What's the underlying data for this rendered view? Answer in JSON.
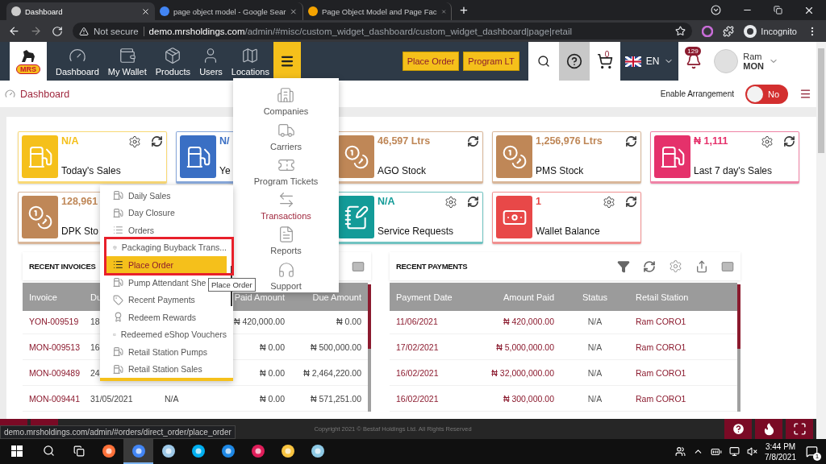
{
  "browser": {
    "tabs": [
      {
        "title": "Dashboard",
        "selected": true
      },
      {
        "title": "page object model - Google Sear",
        "selected": false
      },
      {
        "title": "Page Object Model and Page Fac",
        "selected": false
      }
    ],
    "new_tab": "+",
    "security": "Not secure",
    "url_host": "demo.mrsholdings.com",
    "url_path": "/admin/#misc/custom_widget_dashboard/custom_widget_dashboard|page|retail",
    "profile": "Incognito"
  },
  "nav": {
    "logo": "MRS",
    "items": [
      {
        "label": "Dashboard"
      },
      {
        "label": "My Wallet"
      },
      {
        "label": "Products"
      },
      {
        "label": "Users"
      },
      {
        "label": "Locations"
      }
    ],
    "actions": [
      "Place Order",
      "Program LT"
    ],
    "cart_count": "0",
    "language": "EN",
    "notifications": "129",
    "user": {
      "name": "Ram",
      "org": "MON"
    }
  },
  "toolbar": {
    "breadcrumb": "Dashboard",
    "arrangement_label": "Enable Arrangement",
    "arrangement": {
      "on": false,
      "text": "No"
    }
  },
  "cards": [
    [
      {
        "value": "N/A",
        "label": "Today's Sales",
        "color": "#f5c01b"
      },
      {
        "value": "N/",
        "label": "Ye",
        "color": "#3a6fc4"
      },
      {
        "value": "46,597 Ltrs",
        "label": "AGO Stock",
        "color": "#bf8757"
      },
      {
        "value": "1,256,976 Ltrs",
        "label": "PMS Stock",
        "color": "#bf8757"
      },
      {
        "value": "₦ 1,111",
        "label": "Last 7 day's Sales",
        "color": "#e5316b"
      }
    ],
    [
      {
        "value": "128,961",
        "label": "DPK Sto",
        "color": "#bf8757"
      },
      {
        "value": "N/A",
        "label": "Service Requests",
        "color": "#139b98"
      },
      {
        "value": "1",
        "label": "Wallet Balance",
        "color": "#e84848"
      }
    ]
  ],
  "invoices": {
    "title": "RECENT INVOICES",
    "columns": [
      "Invoice",
      "Du",
      null,
      "Paid Amount",
      "Due Amount"
    ],
    "rows": [
      [
        "YON-009519",
        "18",
        null,
        "₦ 420,000.00",
        "₦ 0.00"
      ],
      [
        "MON-009513",
        "16",
        null,
        "₦ 0.00",
        "₦ 500,000.00"
      ],
      [
        "MON-009489",
        "24",
        null,
        "₦ 0.00",
        "₦ 2,464,220.00"
      ],
      [
        "MON-009441",
        "31/05/2021",
        "N/A",
        "₦ 0.00",
        "₦ 571,251.00"
      ]
    ]
  },
  "payments": {
    "title": "RECENT PAYMENTS",
    "columns": [
      "Payment Date",
      "Amount Paid",
      "Status",
      "Retail Station"
    ],
    "rows": [
      [
        "11/06/2021",
        "₦ 420,000.00",
        "N/A",
        "Ram CORO1"
      ],
      [
        "17/02/2021",
        "₦ 5,000,000.00",
        "N/A",
        "Ram CORO1"
      ],
      [
        "16/02/2021",
        "₦ 32,000,000.00",
        "N/A",
        "Ram CORO1"
      ],
      [
        "16/02/2021",
        "₦ 300,000.00",
        "N/A",
        "Ram CORO1"
      ]
    ]
  },
  "footer": {
    "copyright": "Copyright 2021 © Bestaf Holdings Ltd. All Rights Reserved"
  },
  "mega_menu": [
    {
      "label": "Companies",
      "selected": false
    },
    {
      "label": "Carriers",
      "selected": false
    },
    {
      "label": "Program Tickets",
      "selected": false
    },
    {
      "label": "Transactions",
      "selected": true
    },
    {
      "label": "Reports",
      "selected": false
    },
    {
      "label": "Support",
      "selected": false
    }
  ],
  "dropdown": [
    {
      "label": "Daily Sales",
      "selected": false
    },
    {
      "label": "Day Closure",
      "selected": false
    },
    {
      "label": "Orders",
      "selected": false
    },
    {
      "label": "Packaging Buyback Trans...",
      "selected": false
    },
    {
      "label": "Place Order",
      "selected": true
    },
    {
      "label": "Pump Attendant She",
      "selected": false
    },
    {
      "label": "Recent Payments",
      "selected": false
    },
    {
      "label": "Redeem Rewards",
      "selected": false
    },
    {
      "label": "Redeemed eShop Vouchers",
      "selected": false
    },
    {
      "label": "Retail Station Pumps",
      "selected": false
    },
    {
      "label": "Retail Station Sales",
      "selected": false
    }
  ],
  "tooltip": "Place Order",
  "status_url": "demo.mrsholdings.com/admin/#orders/direct_order/place_order",
  "taskbar": {
    "apps": [
      {
        "selected": false
      },
      {
        "selected": true
      },
      {
        "selected": false
      },
      {
        "selected": false
      },
      {
        "selected": false
      },
      {
        "selected": false
      },
      {
        "selected": false
      },
      {
        "selected": false
      }
    ],
    "time": "3:44 PM",
    "date": "7/8/2021",
    "notifications": "1"
  }
}
